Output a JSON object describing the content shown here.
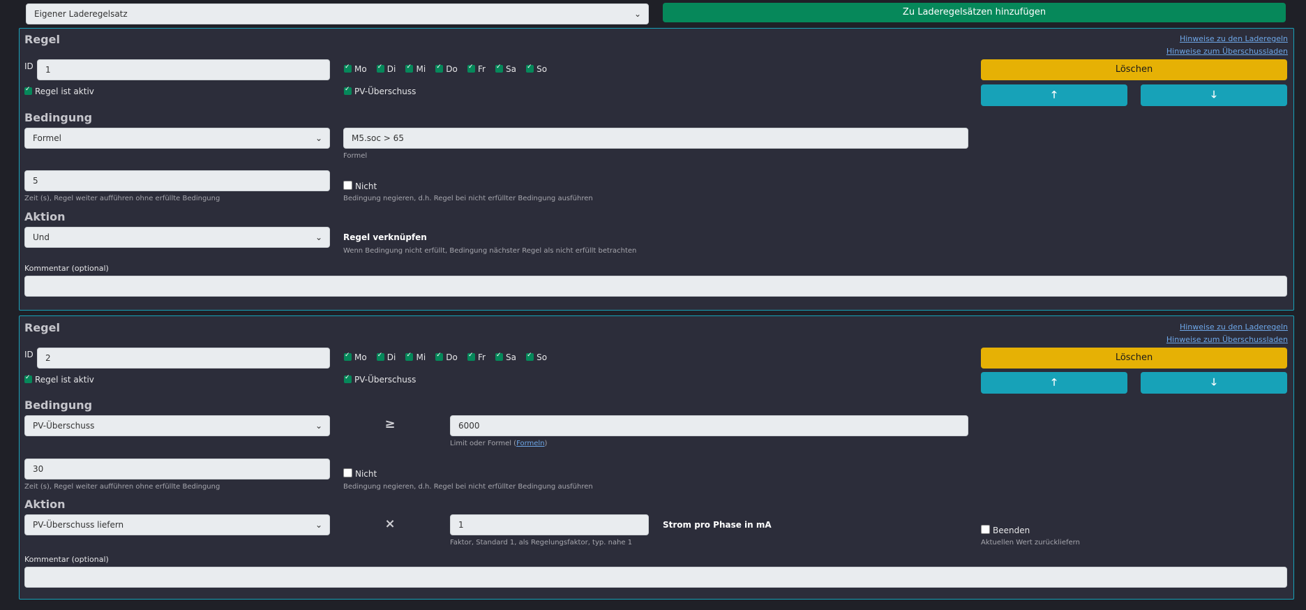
{
  "top": {
    "ruleset_select": "Eigener Laderegelsatz",
    "add_button": "Zu Laderegelsätzen hinzufügen"
  },
  "rules": [
    {
      "title": "Regel",
      "link1": "Hinweise zu den Laderegeln",
      "link2": "Hinweise zum Überschussladen",
      "id_label": "ID",
      "id_value": "1",
      "days": [
        "Mo",
        "Di",
        "Mi",
        "Do",
        "Fr",
        "Sa",
        "So"
      ],
      "active_label": "Regel ist aktiv",
      "pv_label": "PV-Überschuss",
      "delete_button": "Löschen",
      "up_icon": "arrow-up-icon",
      "down_icon": "arrow-down-icon",
      "condition_title": "Bedingung",
      "condition_select": "Formel",
      "formula_value": "M5.soc > 65",
      "formula_hint": "Formel",
      "time_value": "5",
      "time_hint": "Zeit (s), Regel weiter aufführen ohne erfüllte Bedingung",
      "not_label": "Nicht",
      "not_hint": "Bedingung negieren, d.h. Regel bei nicht erfüllter Bedingung ausführen",
      "action_title": "Aktion",
      "action_select": "Und",
      "link_rule_title": "Regel verknüpfen",
      "link_rule_hint": "Wenn Bedingung nicht erfüllt, Bedingung nächster Regel als nicht erfüllt betrachten",
      "comment_label": "Kommentar (optional)",
      "comment_value": ""
    },
    {
      "title": "Regel",
      "link1": "Hinweise zu den Laderegeln",
      "link2": "Hinweise zum Überschussladen",
      "id_label": "ID",
      "id_value": "2",
      "days": [
        "Mo",
        "Di",
        "Mi",
        "Do",
        "Fr",
        "Sa",
        "So"
      ],
      "active_label": "Regel ist aktiv",
      "pv_label": "PV-Überschuss",
      "delete_button": "Löschen",
      "up_icon": "arrow-up-icon",
      "down_icon": "arrow-down-icon",
      "condition_title": "Bedingung",
      "condition_select": "PV-Überschuss",
      "comparator": "≥",
      "limit_value": "6000",
      "limit_hint": "Limit oder Formel (",
      "limit_hint_link": "Formeln",
      "limit_hint_end": ")",
      "time_value": "30",
      "time_hint": "Zeit (s), Regel weiter aufführen ohne erfüllte Bedingung",
      "not_label": "Nicht",
      "not_hint": "Bedingung negieren, d.h. Regel bei nicht erfüllter Bedingung ausführen",
      "action_title": "Aktion",
      "action_select": "PV-Überschuss liefern",
      "multiplier": "×",
      "factor_value": "1",
      "factor_hint": "Faktor, Standard 1, als Regelungsfaktor, typ. nahe 1",
      "current_label": "Strom pro Phase in mA",
      "end_label": "Beenden",
      "end_hint": "Aktuellen Wert zurückliefern",
      "comment_label": "Kommentar (optional)",
      "comment_value": ""
    }
  ]
}
